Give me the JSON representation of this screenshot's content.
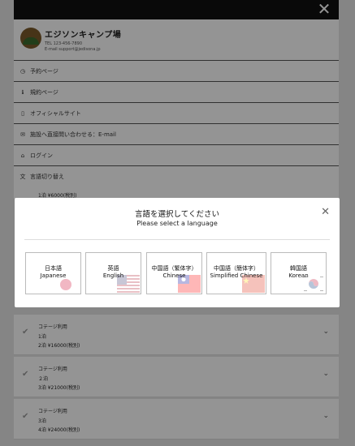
{
  "topbar": {
    "close_glyph": "✕"
  },
  "brand": {
    "title": "エジソンキャンプ場",
    "tel": "TEL 123-456-7890",
    "email": "E-mail support@jedisona.jp"
  },
  "menu": [
    {
      "icon": "clock-icon",
      "glyph": "◷",
      "label": "予約ページ"
    },
    {
      "icon": "info-icon",
      "glyph": "ℹ",
      "label": "規約ページ"
    },
    {
      "icon": "phone-icon",
      "glyph": "▯",
      "label": "オフィシャルサイト"
    },
    {
      "icon": "mail-icon",
      "glyph": "✉",
      "label": "施設へ直接問い合わせる：E-mail"
    },
    {
      "icon": "home-icon",
      "glyph": "⌂",
      "label": "ログイン"
    },
    {
      "icon": "language-icon",
      "glyph": "文",
      "label": "言語切り替え"
    }
  ],
  "background_rows": [
    {
      "line1": "",
      "line2": "1泊 ¥6000(税別)",
      "line3": ""
    },
    {
      "line1": "コテージ利用",
      "line2": "1泊",
      "line3": "2泊 ¥16000(税別)"
    },
    {
      "line1": "コテージ利用",
      "line2": "２泊",
      "line3": "3泊 ¥21000(税別)"
    },
    {
      "line1": "コテージ利用",
      "line2": "3泊",
      "line3": "4泊 ¥24000(税別)"
    }
  ],
  "modal": {
    "title": "言語を選択してください",
    "subtitle": "Please select a language",
    "close_glyph": "✕",
    "languages": [
      {
        "native": "日本語",
        "english": "Japanese",
        "flag": "japan-flag"
      },
      {
        "native": "英語",
        "english": "English",
        "flag": "usa-flag"
      },
      {
        "native": "中国語（繁体字）",
        "english": "Chinese",
        "flag": "taiwan-flag"
      },
      {
        "native": "中国語（簡体字）",
        "english": "Simplified Chinese",
        "flag": "china-flag"
      },
      {
        "native": "韓国語",
        "english": "Korean",
        "flag": "korea-flag"
      }
    ]
  },
  "colors": {
    "topbar": "#111111",
    "overlay": "rgba(0,0,0,0.42)",
    "modal_bg": "#ffffff"
  }
}
